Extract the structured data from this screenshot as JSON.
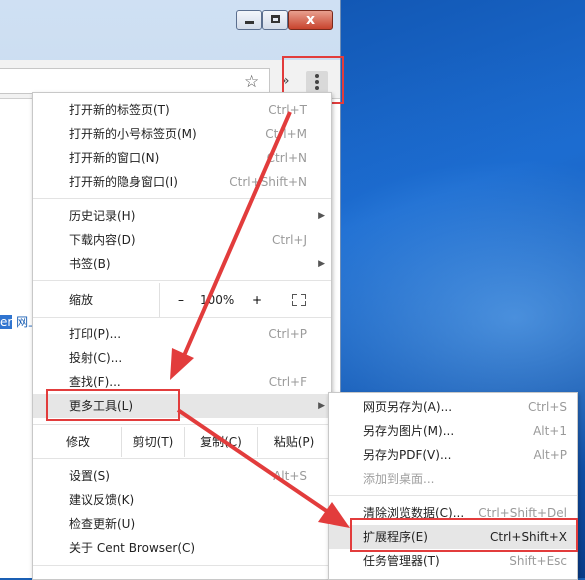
{
  "colors": {
    "accent_red": "#e23c3c",
    "desktop_blue": "#1a5fb4"
  },
  "window": {
    "controls": [
      "minimize-icon",
      "maximize-icon",
      "close-icon"
    ],
    "close_glyph": "x"
  },
  "toolbar": {
    "bookmark_icon": "☆",
    "extensions_icon": "»"
  },
  "page": {
    "link_selected": "er",
    "link_rest": " 网上"
  },
  "menu": {
    "items": [
      {
        "label": "打开新的标签页(T)",
        "shortcut": "Ctrl+T"
      },
      {
        "label": "打开新的小号标签页(M)",
        "shortcut": "Ctrl+M"
      },
      {
        "label": "打开新的窗口(N)",
        "shortcut": "Ctrl+N"
      },
      {
        "label": "打开新的隐身窗口(I)",
        "shortcut": "Ctrl+Shift+N"
      },
      {
        "label": "历史记录(H)",
        "shortcut": ""
      },
      {
        "label": "下载内容(D)",
        "shortcut": "Ctrl+J"
      },
      {
        "label": "书签(B)",
        "shortcut": ""
      },
      {
        "label": "打印(P)...",
        "shortcut": "Ctrl+P"
      },
      {
        "label": "投射(C)...",
        "shortcut": ""
      },
      {
        "label": "查找(F)...",
        "shortcut": "Ctrl+F"
      },
      {
        "label": "更多工具(L)",
        "shortcut": ""
      },
      {
        "label": "设置(S)",
        "shortcut": "Alt+S"
      },
      {
        "label": "建议反馈(K)",
        "shortcut": ""
      },
      {
        "label": "检查更新(U)",
        "shortcut": ""
      },
      {
        "label": "关于 Cent Browser(C)",
        "shortcut": ""
      }
    ],
    "zoom": {
      "label": "缩放",
      "minus": "–",
      "value": "100%",
      "plus": "+"
    },
    "edit": {
      "label": "修改",
      "cut": "剪切(T)",
      "copy": "复制(C)",
      "paste": "粘贴(P)"
    },
    "submenu_arrow": "▶"
  },
  "submenu": {
    "items": [
      {
        "label": "网页另存为(A)...",
        "shortcut": "Ctrl+S"
      },
      {
        "label": "另存为图片(M)...",
        "shortcut": "Alt+1"
      },
      {
        "label": "另存为PDF(V)...",
        "shortcut": "Alt+P"
      },
      {
        "label": "添加到桌面...",
        "shortcut": ""
      },
      {
        "label": "清除浏览数据(C)...",
        "shortcut": "Ctrl+Shift+Del"
      },
      {
        "label": "扩展程序(E)",
        "shortcut": "Ctrl+Shift+X"
      },
      {
        "label": "任务管理器(T)",
        "shortcut": "Shift+Esc"
      }
    ]
  }
}
